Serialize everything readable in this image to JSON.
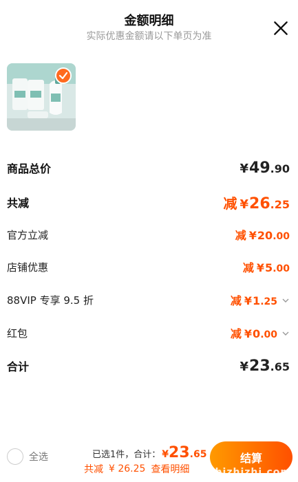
{
  "header": {
    "title": "金额明细",
    "subtitle": "实际优惠金额请以下单页为准"
  },
  "icons": {
    "close": "close-icon",
    "check": "check-icon",
    "chevron": "chevron-down-icon"
  },
  "colors": {
    "accent": "#ff5000",
    "check_badge": "#ff6a1f"
  },
  "rows": [
    {
      "label": "商品总价",
      "minus": "",
      "yen": "¥",
      "int": "49",
      "dec": ".90"
    },
    {
      "label": "共减",
      "minus": "减",
      "yen": "¥",
      "int": "26",
      "dec": ".25"
    },
    {
      "label": "官方立减",
      "minus": "减",
      "yen": "¥",
      "int": "20",
      "dec": ".00"
    },
    {
      "label": "店铺优惠",
      "minus": "减",
      "yen": "¥",
      "int": "5",
      "dec": ".00"
    },
    {
      "label": "88VIP 专享 9.5 折",
      "minus": "减",
      "yen": "¥",
      "int": "1",
      "dec": ".25"
    },
    {
      "label": "红包",
      "minus": "减",
      "yen": "¥",
      "int": "0",
      "dec": ".00"
    },
    {
      "label": "合计",
      "minus": "",
      "yen": "¥",
      "int": "23",
      "dec": ".65"
    }
  ],
  "footer": {
    "select_all": "全选",
    "selected": "已选1件，合计：",
    "yen": "¥",
    "total_int": "23",
    "total_dec": ".65",
    "discount_label": "共减",
    "discount_value": "¥ 26.25",
    "view_detail": "查看明细",
    "checkout": "结算"
  },
  "watermark": "zhizhizhi.com"
}
